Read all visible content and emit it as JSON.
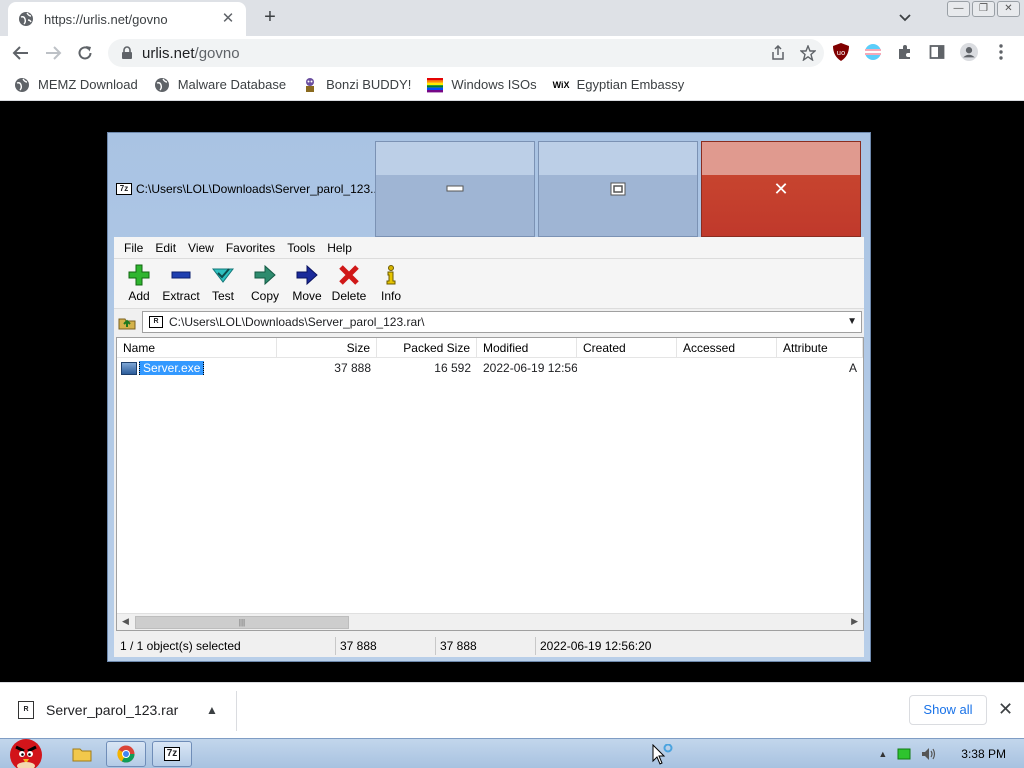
{
  "browser": {
    "tab_title": "https://urlis.net/govno",
    "url_host": "urlis.net",
    "url_path": "/govno",
    "bookmarks": [
      {
        "label": "MEMZ Download",
        "icon": "globe-icon"
      },
      {
        "label": "Malware Database",
        "icon": "globe-icon"
      },
      {
        "label": "Bonzi BUDDY!",
        "icon": "bonzi-icon"
      },
      {
        "label": "Windows ISOs",
        "icon": "rainbow-flag-icon"
      },
      {
        "label": "Egyptian Embassy",
        "icon": "wix-icon"
      }
    ],
    "wix_text": "WiX"
  },
  "app": {
    "title": "C:\\Users\\LOL\\Downloads\\Server_parol_123...",
    "logo_text": "7z",
    "menu": [
      "File",
      "Edit",
      "View",
      "Favorites",
      "Tools",
      "Help"
    ],
    "tools": [
      {
        "label": "Add",
        "icon": "add-icon"
      },
      {
        "label": "Extract",
        "icon": "extract-icon"
      },
      {
        "label": "Test",
        "icon": "test-icon"
      },
      {
        "label": "Copy",
        "icon": "copy-icon"
      },
      {
        "label": "Move",
        "icon": "move-icon"
      },
      {
        "label": "Delete",
        "icon": "delete-icon"
      },
      {
        "label": "Info",
        "icon": "info-icon"
      }
    ],
    "address": "C:\\Users\\LOL\\Downloads\\Server_parol_123.rar\\",
    "archive_icon_text": "R",
    "columns": [
      "Name",
      "Size",
      "Packed Size",
      "Modified",
      "Created",
      "Accessed",
      "Attribute"
    ],
    "rows": [
      {
        "name": "Server.exe",
        "size": "37 888",
        "packed": "16 592",
        "modified": "2022-06-19 12:56",
        "created": "",
        "accessed": "",
        "attr": "A"
      }
    ],
    "status": {
      "selection": "1 / 1 object(s) selected",
      "size": "37 888",
      "packed": "37 888",
      "modified": "2022-06-19 12:56:20"
    }
  },
  "downloads": {
    "file": "Server_parol_123.rar",
    "show_all": "Show all"
  },
  "taskbar": {
    "clock": "3:38 PM"
  },
  "colors": {
    "close_red": "#c0392b",
    "selection_blue": "#3399ff",
    "link_blue": "#1a73e8"
  }
}
